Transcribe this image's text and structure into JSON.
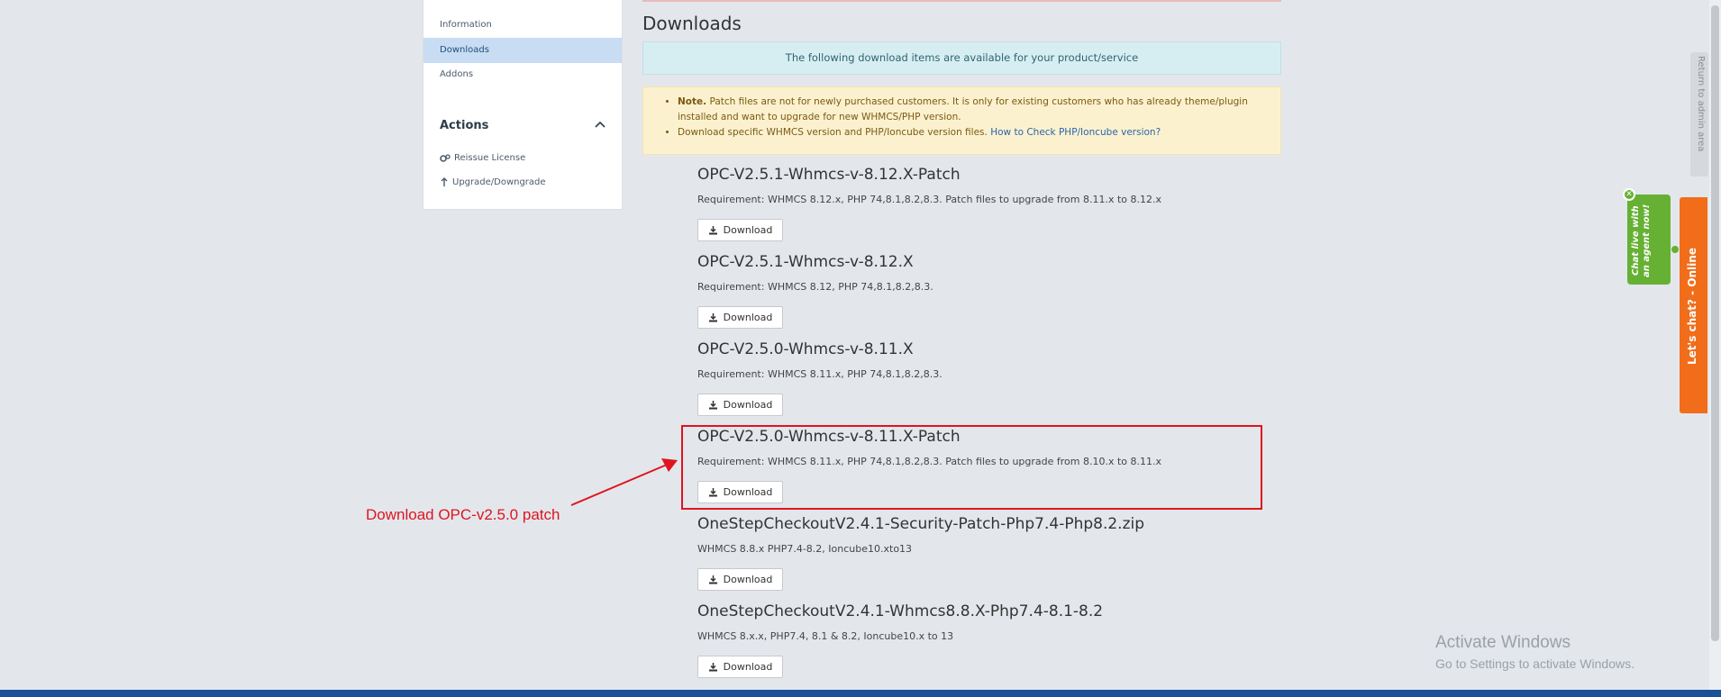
{
  "sidebar": {
    "links": [
      {
        "label": "Information"
      },
      {
        "label": "Downloads"
      },
      {
        "label": "Addons"
      }
    ],
    "actions_title": "Actions",
    "actions": [
      {
        "label": "Reissue License",
        "icon": "gears-icon"
      },
      {
        "label": "Upgrade/Downgrade",
        "icon": "arrow-up-icon"
      }
    ]
  },
  "main": {
    "title": "Downloads",
    "info": "The following download items are available for your product/service",
    "note": {
      "bold": "Note.",
      "line1": "Patch files are not for newly purchased customers. It is only for existing customers who has already theme/plugin installed and want to upgrade for new WHMCS/PHP version.",
      "line2": "Download specific WHMCS version and PHP/Ioncube version files.",
      "link": "How to Check PHP/Ioncube version?"
    },
    "button_label": "Download",
    "downloads": [
      {
        "title": "OPC-V2.5.1-Whmcs-v-8.12.X-Patch",
        "req": "Requirement: WHMCS 8.12.x, PHP 74,8.1,8.2,8.3. Patch files to upgrade from 8.11.x to 8.12.x"
      },
      {
        "title": "OPC-V2.5.1-Whmcs-v-8.12.X",
        "req": "Requirement: WHMCS 8.12, PHP 74,8.1,8.2,8.3."
      },
      {
        "title": "OPC-V2.5.0-Whmcs-v-8.11.X",
        "req": "Requirement: WHMCS 8.11.x, PHP 74,8.1,8.2,8.3."
      },
      {
        "title": "OPC-V2.5.0-Whmcs-v-8.11.X-Patch",
        "req": "Requirement: WHMCS 8.11.x, PHP 74,8.1,8.2,8.3. Patch files to upgrade from 8.10.x to 8.11.x"
      },
      {
        "title": "OneStepCheckoutV2.4.1-Security-Patch-Php7.4-Php8.2.zip",
        "req": "WHMCS 8.8.x PHP7.4-8.2, Ioncube10.xto13"
      },
      {
        "title": "OneStepCheckoutV2.4.1-Whmcs8.8.X-Php7.4-8.1-8.2",
        "req": "WHMCS 8.x.x, PHP7.4, 8.1 & 8.2, Ioncube10.x to 13"
      }
    ]
  },
  "annotation": {
    "text": "Download OPC-v2.5.0 patch",
    "color": "#e0141e"
  },
  "widgets": {
    "return_admin": "Return to admin area",
    "chat_prompt": "Chat live with an agent now!",
    "chat_tab": "Let's chat? - Online",
    "close": "✕"
  },
  "watermark": {
    "title": "Activate Windows",
    "subtitle": "Go to Settings to activate Windows."
  }
}
